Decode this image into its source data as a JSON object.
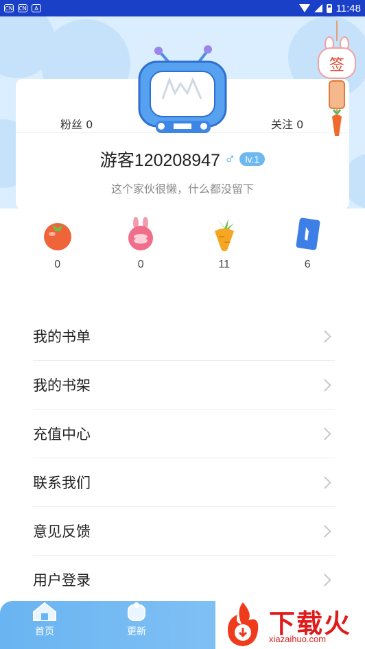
{
  "status_bar": {
    "time": "11:48",
    "left_icons": [
      "cn-icon",
      "cn-icon",
      "a-icon"
    ]
  },
  "profile": {
    "fans_label": "粉丝 0",
    "follow_label": "关注 0",
    "username": "游客120208947",
    "gender_icon": "male-icon",
    "level": "lv.1",
    "bio": "这个家伙很懒，什么都没留下",
    "sign_button": "签"
  },
  "stats": [
    {
      "icon": "tomato-icon",
      "value": "0"
    },
    {
      "icon": "rabbit-coin-icon",
      "value": "0"
    },
    {
      "icon": "carrot-icon",
      "value": "11"
    },
    {
      "icon": "card-icon",
      "value": "6"
    }
  ],
  "menu": [
    {
      "label": "我的书单"
    },
    {
      "label": "我的书架"
    },
    {
      "label": "充值中心"
    },
    {
      "label": "联系我们"
    },
    {
      "label": "意见反馈"
    },
    {
      "label": "用户登录"
    }
  ],
  "bottom_nav": [
    {
      "label": "首页",
      "icon": "home-icon"
    },
    {
      "label": "更新",
      "icon": "update-icon"
    }
  ],
  "watermark": {
    "title": "下载火",
    "url": "xiazaihuo.com"
  },
  "colors": {
    "status_bar": "#1a40c8",
    "header_bg": "#daeeff",
    "accent": "#47a6f0",
    "watermark": "#e01b1b"
  }
}
